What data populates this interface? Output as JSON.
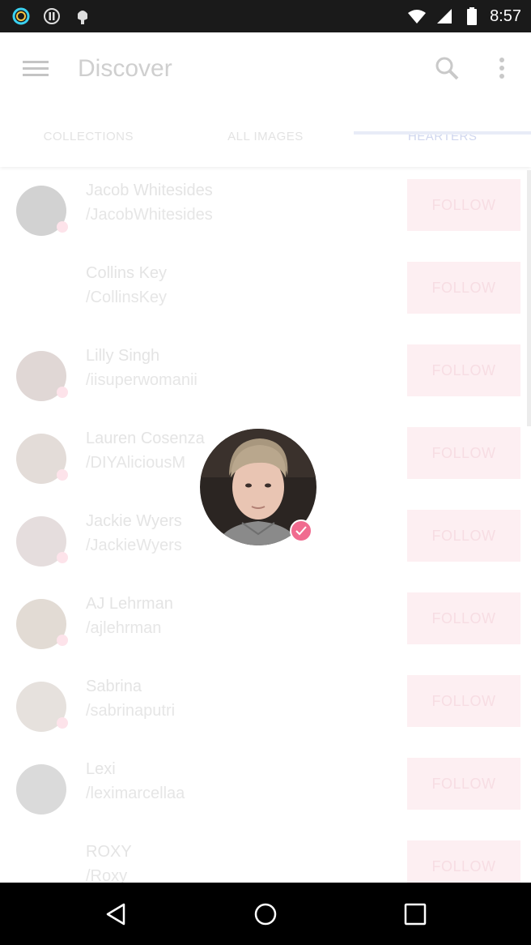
{
  "status_bar": {
    "time": "8:57"
  },
  "app_bar": {
    "title": "Discover"
  },
  "tabs": [
    {
      "label": "COLLECTIONS"
    },
    {
      "label": "ALL IMAGES"
    },
    {
      "label": "HEARTERS"
    }
  ],
  "list": [
    {
      "name": "Jacob Whitesides",
      "handle": "/JacobWhitesides",
      "follow": "FOLLOW"
    },
    {
      "name": "Collins Key",
      "handle": "/CollinsKey",
      "follow": "FOLLOW"
    },
    {
      "name": "Lilly Singh",
      "handle": "/iisuperwomanii",
      "follow": "FOLLOW"
    },
    {
      "name": "Lauren Cosenza",
      "handle": "/DIYAliciousM",
      "follow": "FOLLOW"
    },
    {
      "name": "Jackie Wyers",
      "handle": "/JackieWyers",
      "follow": "FOLLOW"
    },
    {
      "name": "AJ Lehrman",
      "handle": "/ajlehrman",
      "follow": "FOLLOW"
    },
    {
      "name": "Sabrina",
      "handle": "/sabrinaputri",
      "follow": "FOLLOW"
    },
    {
      "name": "Lexi",
      "handle": "/leximarcellaa",
      "follow": "FOLLOW"
    },
    {
      "name": "ROXY",
      "handle": "/Roxy",
      "follow": "FOLLOW"
    }
  ],
  "colors": {
    "accent": "#f06b8f",
    "follow_bg": "#fdeff2",
    "status_bar": "#1a1a1a"
  }
}
